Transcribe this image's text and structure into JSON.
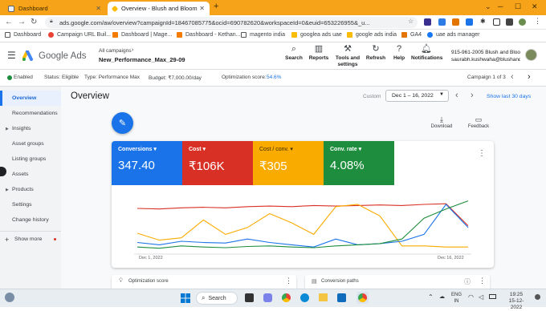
{
  "browser": {
    "tabs": [
      {
        "label": "Dashboard",
        "active": false
      },
      {
        "label": "Overview - Blush and Bloom UAE",
        "active": true
      }
    ],
    "new_tab": "+",
    "address": "ads.google.com/aw/overview?campaignId=18467085775&ocid=690782620&workspaceId=0&euid=653226955&_u...",
    "bookmarks": [
      "Dashboard",
      "Campaign URL Buil...",
      "Dashboard | Mage...",
      "Dashboard - Kethan...",
      "magento india",
      "googlea ads uae",
      "google ads india",
      "GA4",
      "uae ads manager"
    ]
  },
  "ads_header": {
    "product": "Google Ads",
    "breadcrumb": "All campaigns",
    "campaign": "New_Performance_Max_29-09",
    "actions": [
      {
        "label": "Search",
        "icon": "search-icon"
      },
      {
        "label": "Reports",
        "icon": "reports-icon"
      },
      {
        "label": "Tools and settings",
        "icon": "tools-icon"
      },
      {
        "label": "Refresh",
        "icon": "refresh-icon"
      },
      {
        "label": "Help",
        "icon": "help-icon"
      },
      {
        "label": "Notifications",
        "icon": "bell-icon"
      }
    ],
    "account_line1": "915-961-2005 Blush and Bloo...",
    "account_line2": "saurabh.kushwaha@blushand..."
  },
  "subbar": {
    "status": "Enabled",
    "status_label": "Status: Eligible",
    "type": "Type: Performance Max",
    "budget": "Budget: ₹7,000.00/day",
    "opt_label": "Optimization score:",
    "opt_value": "54.6%",
    "pager": "Campaign 1 of 3"
  },
  "sidebar": [
    {
      "label": "Overview",
      "active": true,
      "caret": false
    },
    {
      "label": "Recommendations",
      "active": false,
      "caret": false
    },
    {
      "label": "Insights",
      "active": false,
      "caret": true
    },
    {
      "label": "Asset groups",
      "active": false,
      "caret": false
    },
    {
      "label": "Listing groups",
      "active": false,
      "caret": false
    },
    {
      "label": "Assets",
      "active": false,
      "caret": false
    },
    {
      "label": "Products",
      "active": false,
      "caret": true
    },
    {
      "label": "Settings",
      "active": false,
      "caret": false
    },
    {
      "label": "Change history",
      "active": false,
      "caret": false
    }
  ],
  "show_more": "Show more",
  "main": {
    "title": "Overview",
    "custom": "Custom",
    "date_range": "Dec 1 – 16, 2022",
    "last30": "Show last 30 days",
    "download": "Download",
    "feedback": "Feedback",
    "card1": "Optimization score",
    "card2": "Conversion paths"
  },
  "metrics": [
    {
      "label": "Conversions",
      "value": "347.40",
      "color": "#1a73e8"
    },
    {
      "label": "Cost",
      "value": "₹106K",
      "color": "#d93025"
    },
    {
      "label": "Cost / conv.",
      "value": "₹305",
      "color": "#f9ab00"
    },
    {
      "label": "Conv. rate",
      "value": "4.08%",
      "color": "#1e8e3e"
    }
  ],
  "chart_data": {
    "type": "line",
    "x_labels": [
      "Dec 1, 2022",
      "Dec 16, 2022"
    ],
    "series": [
      {
        "color": "#d93025",
        "values": [
          0.75,
          0.74,
          0.76,
          0.77,
          0.76,
          0.78,
          0.79,
          0.78,
          0.8,
          0.79,
          0.8,
          0.81,
          0.8,
          0.82,
          0.83,
          0.45
        ]
      },
      {
        "color": "#f9ab00",
        "values": [
          0.32,
          0.2,
          0.24,
          0.55,
          0.3,
          0.42,
          0.66,
          0.5,
          0.3,
          0.78,
          0.82,
          0.62,
          0.1,
          0.1,
          0.08,
          0.08
        ]
      },
      {
        "color": "#1a73e8",
        "values": [
          0.16,
          0.12,
          0.18,
          0.16,
          0.15,
          0.22,
          0.16,
          0.12,
          0.08,
          0.22,
          0.12,
          0.14,
          0.18,
          0.3,
          0.82,
          0.42
        ]
      },
      {
        "color": "#1e8e3e",
        "values": [
          0.08,
          0.06,
          0.1,
          0.08,
          0.07,
          0.09,
          0.1,
          0.08,
          0.07,
          0.1,
          0.12,
          0.14,
          0.22,
          0.58,
          0.74,
          0.88
        ]
      }
    ]
  },
  "taskbar": {
    "search": "Search",
    "lang1": "ENG",
    "lang2": "IN",
    "time": "19:25",
    "date": "15-12-2022"
  }
}
